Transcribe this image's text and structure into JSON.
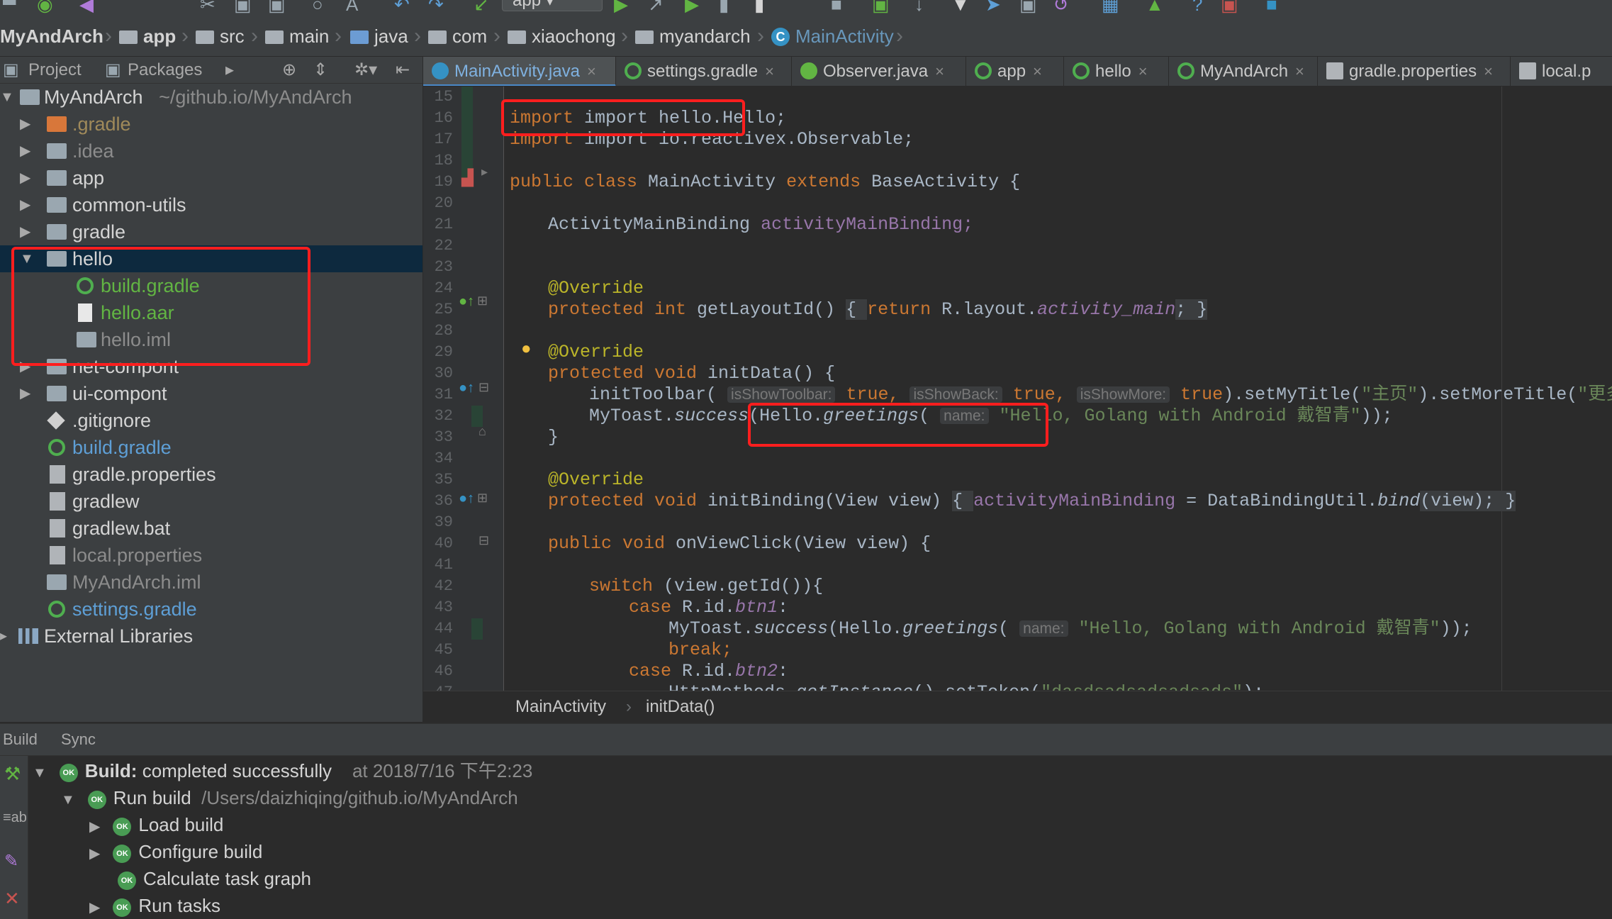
{
  "toolbar": {
    "run_config": "app"
  },
  "navbar": {
    "crumbs": [
      "MyAndArch",
      "app",
      "src",
      "main",
      "java",
      "com",
      "xiaochong",
      "myandarch",
      "MainActivity"
    ]
  },
  "project_panel": {
    "tab_project": "Project",
    "tab_packages": "Packages",
    "root": {
      "label": "MyAndArch",
      "path": "~/github.io/MyAndArch"
    },
    "items": [
      {
        "label": ".gradle"
      },
      {
        "label": ".idea"
      },
      {
        "label": "app"
      },
      {
        "label": "common-utils"
      },
      {
        "label": "gradle"
      },
      {
        "label": "hello"
      },
      {
        "label": "build.gradle"
      },
      {
        "label": "hello.aar"
      },
      {
        "label": "hello.iml"
      },
      {
        "label": "net-compont"
      },
      {
        "label": "ui-compont"
      },
      {
        "label": ".gitignore"
      },
      {
        "label": "build.gradle"
      },
      {
        "label": "gradle.properties"
      },
      {
        "label": "gradlew"
      },
      {
        "label": "gradlew.bat"
      },
      {
        "label": "local.properties"
      },
      {
        "label": "MyAndArch.iml"
      },
      {
        "label": "settings.gradle"
      }
    ],
    "external": "External Libraries"
  },
  "tabs": [
    {
      "label": "MainActivity.java"
    },
    {
      "label": "settings.gradle"
    },
    {
      "label": "Observer.java"
    },
    {
      "label": "app"
    },
    {
      "label": "hello"
    },
    {
      "label": "MyAndArch"
    },
    {
      "label": "gradle.properties"
    },
    {
      "label": "local.p"
    }
  ],
  "code": {
    "line_numbers": [
      "15",
      "16",
      "17",
      "18",
      "19",
      "20",
      "21",
      "22",
      "23",
      "24",
      "25",
      "28",
      "29",
      "30",
      "31",
      "32",
      "33",
      "34",
      "35",
      "36",
      "39",
      "40",
      "41",
      "42",
      "43",
      "44",
      "45",
      "46",
      "47"
    ],
    "l16": "import hello.Hello;",
    "l17a": "import io.reactivex.",
    "l17b": "Observable;",
    "l19": [
      "public class ",
      "MainActivity ",
      "extends ",
      "BaseActivity {"
    ],
    "l21": [
      "ActivityMainBinding ",
      "activityMainBinding;"
    ],
    "l24": "@Override",
    "l25": [
      "protected int ",
      "getLayoutId() ",
      "{ ",
      "return ",
      "R.layout.",
      "activity_main",
      "; }"
    ],
    "l29": "@Override",
    "l30": [
      "protected void ",
      "initData() {"
    ],
    "l31": [
      "initToolbar( ",
      "isShowToolbar:",
      " true, ",
      "isShowBack:",
      " true, ",
      "isShowMore:",
      " true",
      ").setMyTitle(",
      "\"主页\"",
      ").setMoreTitle(",
      "\"更多\""
    ],
    "l32": [
      "MyToast.",
      "success",
      "(",
      "Hello.",
      "greetings",
      "( ",
      "name:",
      " \"Hello, Golang with Android 戴智青\"",
      "));"
    ],
    "l33": "}",
    "l35": "@Override",
    "l36": [
      "protected void ",
      "initBinding(View view) ",
      "{ ",
      "activityMainBinding",
      " = DataBindingUtil.",
      "bind",
      "(view); }"
    ],
    "l40": [
      "public void ",
      "onViewClick(View view) {"
    ],
    "l42": [
      "switch ",
      "(view.getId()){"
    ],
    "l43": [
      "case ",
      "R.id.",
      "btn1",
      ":"
    ],
    "l44": [
      "MyToast.",
      "success",
      "(Hello.",
      "greetings",
      "( ",
      "name:",
      " \"Hello, Golang with Android 戴智青\"",
      "));"
    ],
    "l45": "break;",
    "l46": [
      "case ",
      "R.id.",
      "btn2",
      ":"
    ],
    "l47": [
      "HttpMethods.",
      "getInstance",
      "().setToken(",
      "\"dasdsadsadsadsads\"",
      ");"
    ]
  },
  "editor_breadcrumb": {
    "class": "MainActivity",
    "method": "initData()"
  },
  "build_panel": {
    "tab_build": "Build",
    "tab_sync": "Sync",
    "status_label": "Build:",
    "status": "completed successfully",
    "time": "at 2018/7/16 下午2:23",
    "run_build": "Run build",
    "run_path": "/Users/daizhiqing/github.io/MyAndArch",
    "tasks": [
      "Load build",
      "Configure build",
      "Calculate task graph",
      "Run tasks"
    ],
    "ok_badge": "OK"
  },
  "colors": {
    "highlight_box": "#ff1e1e",
    "keyword": "#cc7832",
    "string": "#6a8759",
    "annotation": "#bbb529",
    "field": "#9876aa",
    "selection": "#0d293e"
  }
}
